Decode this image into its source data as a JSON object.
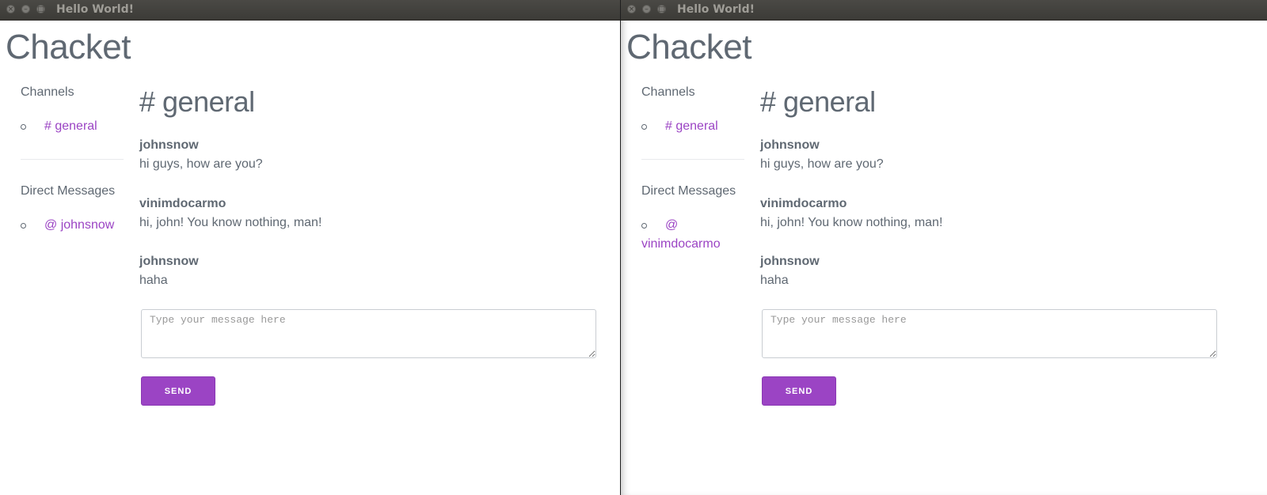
{
  "left_window": {
    "window_title": "Hello World!",
    "app_title": "Chacket",
    "sidebar": {
      "channels_title": "Channels",
      "channels": [
        {
          "label": "# general"
        }
      ],
      "dm_title": "Direct Messages",
      "direct_messages": [
        {
          "label": "@ johnsnow"
        }
      ]
    },
    "main": {
      "channel_title": "# general",
      "messages": [
        {
          "author": "johnsnow",
          "text": "hi guys, how are you?"
        },
        {
          "author": "vinimdocarmo",
          "text": "hi, john! You know nothing, man!"
        },
        {
          "author": "johnsnow",
          "text": "haha"
        }
      ],
      "input_placeholder": "Type your message here",
      "send_label": "SEND"
    }
  },
  "right_window": {
    "window_title": "Hello World!",
    "app_title": "Chacket",
    "sidebar": {
      "channels_title": "Channels",
      "channels": [
        {
          "label": "# general"
        }
      ],
      "dm_title": "Direct Messages",
      "direct_messages": [
        {
          "label": "@ vinimdocarmo"
        }
      ]
    },
    "main": {
      "channel_title": "# general",
      "messages": [
        {
          "author": "johnsnow",
          "text": "hi guys, how are you?"
        },
        {
          "author": "vinimdocarmo",
          "text": "hi, john! You know nothing, man!"
        },
        {
          "author": "johnsnow",
          "text": "haha"
        }
      ],
      "input_placeholder": "Type your message here",
      "send_label": "SEND"
    }
  },
  "colors": {
    "accent": "#9b44c4",
    "text": "#5f6872",
    "titlebar": "#3c3b37"
  }
}
